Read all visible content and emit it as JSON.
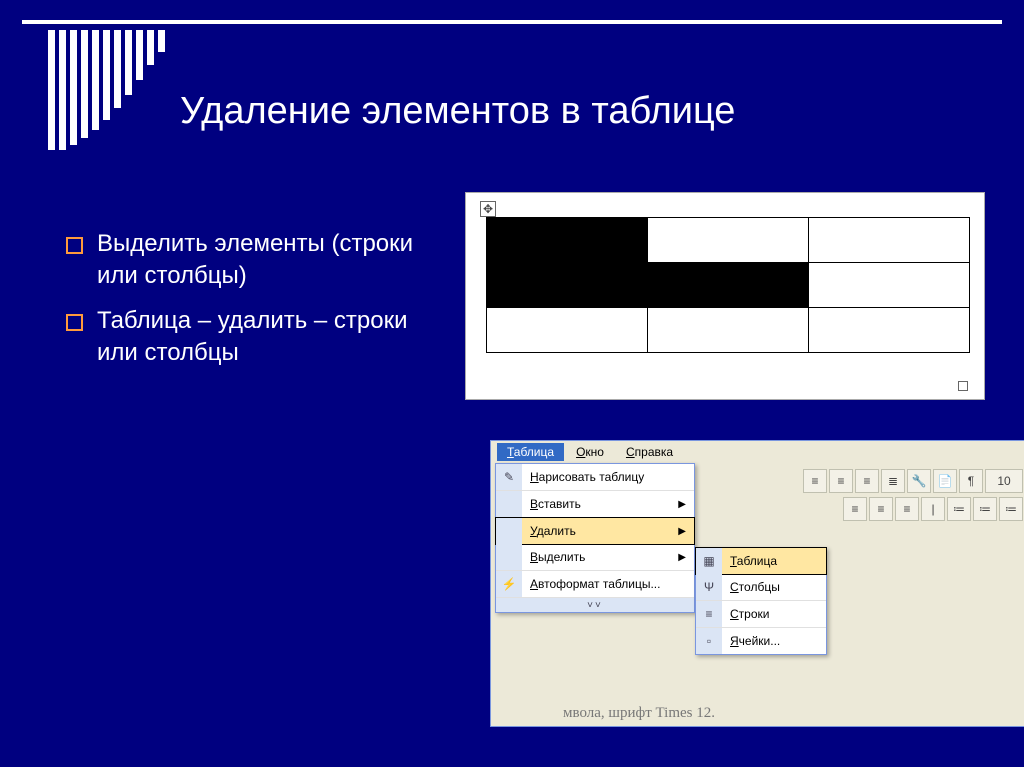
{
  "title": "Удаление элементов в таблице",
  "bullets": [
    "Выделить элементы (строки или столбцы)",
    "Таблица – удалить – строки или столбцы"
  ],
  "decorative_bar_heights": [
    120,
    120,
    115,
    108,
    100,
    90,
    78,
    65,
    50,
    35,
    22
  ],
  "table_demo": {
    "rows": 3,
    "cols": 3,
    "selected_cells": [
      [
        0,
        0
      ],
      [
        1,
        0
      ],
      [
        1,
        1
      ]
    ]
  },
  "word_menu": {
    "menubar": [
      {
        "label": "Таблица",
        "open": true,
        "underline": 0
      },
      {
        "label": "Окно",
        "open": false,
        "underline": 0
      },
      {
        "label": "Справка",
        "open": false,
        "underline": 0
      }
    ],
    "toolbar_row1": [
      "≡",
      "≡",
      "≡",
      "≣",
      "🔧",
      "📄",
      "¶",
      "10"
    ],
    "toolbar_row2": [
      "≡",
      "≡",
      "≡",
      "|",
      "≔",
      "≔",
      "≔"
    ],
    "dropdown": [
      {
        "label": "Нарисовать таблицу",
        "icon": "✎",
        "arrow": false,
        "hl": false,
        "underline": true
      },
      {
        "label": "Вставить",
        "icon": "",
        "arrow": true,
        "hl": false,
        "underline": true
      },
      {
        "label": "Удалить",
        "icon": "",
        "arrow": true,
        "hl": true,
        "underline": true
      },
      {
        "label": "Выделить",
        "icon": "",
        "arrow": true,
        "hl": false,
        "underline": true
      },
      {
        "label": "Автоформат таблицы...",
        "icon": "⚡",
        "arrow": false,
        "hl": false,
        "underline": true
      }
    ],
    "submenu": [
      {
        "label": "Таблица",
        "icon": "▦",
        "hl": true
      },
      {
        "label": "Столбцы",
        "icon": "Ψ",
        "hl": false
      },
      {
        "label": "Строки",
        "icon": "≡",
        "hl": false
      },
      {
        "label": "Ячейки...",
        "icon": "▫",
        "hl": false
      }
    ],
    "expand_glyph": "˅˅",
    "status_fragment": "мвола, шрифт Times 12."
  }
}
